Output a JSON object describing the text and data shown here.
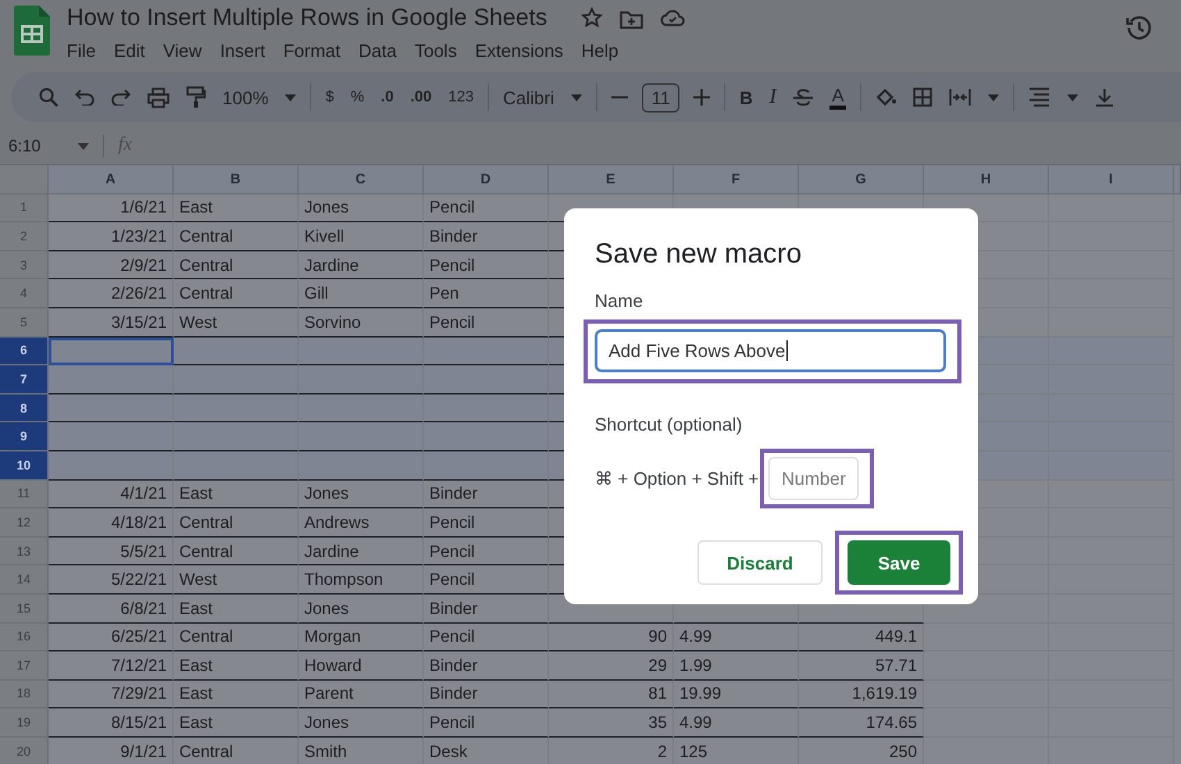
{
  "document": {
    "title": "How to Insert Multiple Rows in Google Sheets",
    "menu": [
      "File",
      "Edit",
      "View",
      "Insert",
      "Format",
      "Data",
      "Tools",
      "Extensions",
      "Help"
    ]
  },
  "toolbar": {
    "zoom": "100%",
    "currency": "$",
    "percent": "%",
    "decrease_decimal": ".0",
    "increase_decimal": ".00",
    "number_format": "123",
    "font": "Calibri",
    "font_size": "11",
    "bold": "B",
    "italic": "I",
    "text_color": "A"
  },
  "formula_bar": {
    "name_box": "6:10",
    "fx": "fx"
  },
  "sheet": {
    "columns": [
      "A",
      "B",
      "C",
      "D",
      "E",
      "F",
      "G",
      "H",
      "I"
    ],
    "rows": [
      {
        "number": "1",
        "selected": false,
        "cursor": false,
        "cells": [
          "1/6/21",
          "East",
          "Jones",
          "Pencil"
        ]
      },
      {
        "number": "2",
        "selected": false,
        "cursor": false,
        "cells": [
          "1/23/21",
          "Central",
          "Kivell",
          "Binder"
        ]
      },
      {
        "number": "3",
        "selected": false,
        "cursor": false,
        "cells": [
          "2/9/21",
          "Central",
          "Jardine",
          "Pencil"
        ]
      },
      {
        "number": "4",
        "selected": false,
        "cursor": false,
        "cells": [
          "2/26/21",
          "Central",
          "Gill",
          "Pen"
        ]
      },
      {
        "number": "5",
        "selected": false,
        "cursor": false,
        "cells": [
          "3/15/21",
          "West",
          "Sorvino",
          "Pencil"
        ]
      },
      {
        "number": "6",
        "selected": true,
        "cursor": true,
        "cells": []
      },
      {
        "number": "7",
        "selected": true,
        "cursor": false,
        "cells": []
      },
      {
        "number": "8",
        "selected": true,
        "cursor": false,
        "cells": []
      },
      {
        "number": "9",
        "selected": true,
        "cursor": false,
        "cells": []
      },
      {
        "number": "10",
        "selected": true,
        "cursor": false,
        "cells": []
      },
      {
        "number": "11",
        "selected": false,
        "cursor": false,
        "cells": [
          "4/1/21",
          "East",
          "Jones",
          "Binder"
        ]
      },
      {
        "number": "12",
        "selected": false,
        "cursor": false,
        "cells": [
          "4/18/21",
          "Central",
          "Andrews",
          "Pencil"
        ]
      },
      {
        "number": "13",
        "selected": false,
        "cursor": false,
        "cells": [
          "5/5/21",
          "Central",
          "Jardine",
          "Pencil"
        ]
      },
      {
        "number": "14",
        "selected": false,
        "cursor": false,
        "cells": [
          "5/22/21",
          "West",
          "Thompson",
          "Pencil"
        ]
      },
      {
        "number": "15",
        "selected": false,
        "cursor": false,
        "cells": [
          "6/8/21",
          "East",
          "Jones",
          "Binder"
        ]
      },
      {
        "number": "16",
        "selected": false,
        "cursor": false,
        "cells": [
          "6/25/21",
          "Central",
          "Morgan",
          "Pencil",
          "90",
          "4.99",
          "449.1"
        ]
      },
      {
        "number": "17",
        "selected": false,
        "cursor": false,
        "cells": [
          "7/12/21",
          "East",
          "Howard",
          "Binder",
          "29",
          "1.99",
          "57.71"
        ]
      },
      {
        "number": "18",
        "selected": false,
        "cursor": false,
        "cells": [
          "7/29/21",
          "East",
          "Parent",
          "Binder",
          "81",
          "19.99",
          "1,619.19"
        ]
      },
      {
        "number": "19",
        "selected": false,
        "cursor": false,
        "cells": [
          "8/15/21",
          "East",
          "Jones",
          "Pencil",
          "35",
          "4.99",
          "174.65"
        ]
      },
      {
        "number": "20",
        "selected": false,
        "cursor": false,
        "cells": [
          "9/1/21",
          "Central",
          "Smith",
          "Desk",
          "2",
          "125",
          "250"
        ]
      }
    ]
  },
  "dialog": {
    "title": "Save new macro",
    "name_field": {
      "label": "Name",
      "value": "Add Five Rows Above",
      "focused": true,
      "highlighted": true
    },
    "shortcut": {
      "label": "Shortcut (optional)",
      "keys": "⌘ + Option + Shift +",
      "placeholder": "Number",
      "highlighted": true
    },
    "buttons": [
      {
        "label": "Discard",
        "kind": "secondary",
        "highlighted": false
      },
      {
        "label": "Save",
        "kind": "primary",
        "highlighted": true
      }
    ]
  }
}
